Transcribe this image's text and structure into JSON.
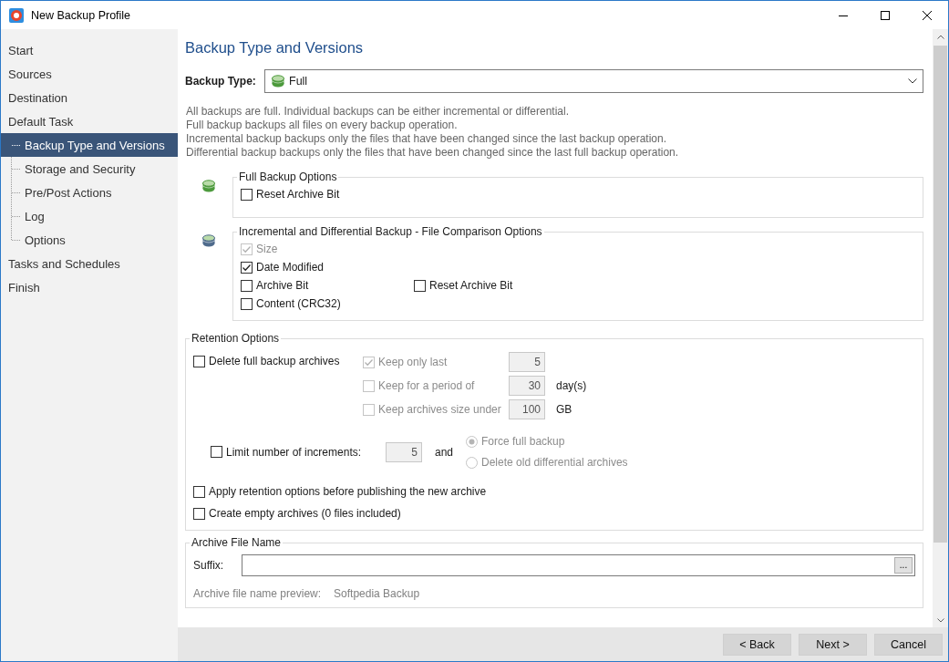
{
  "window": {
    "title": "New Backup Profile"
  },
  "sidebar": {
    "items": [
      {
        "label": "Start",
        "selected": false
      },
      {
        "label": "Sources",
        "selected": false
      },
      {
        "label": "Destination",
        "selected": false
      },
      {
        "label": "Default Task",
        "selected": false,
        "children": [
          {
            "label": "Backup Type and Versions",
            "selected": true
          },
          {
            "label": "Storage and Security",
            "selected": false
          },
          {
            "label": "Pre/Post Actions",
            "selected": false
          },
          {
            "label": "Log",
            "selected": false
          },
          {
            "label": "Options",
            "selected": false
          }
        ]
      },
      {
        "label": "Tasks and Schedules",
        "selected": false
      },
      {
        "label": "Finish",
        "selected": false
      }
    ]
  },
  "page_title": "Backup Type and Versions",
  "backup_type": {
    "label": "Backup Type:",
    "value": "Full"
  },
  "description": [
    "All backups are full. Individual backups can be either incremental or differential.",
    "Full backup backups all files on every backup operation.",
    "Incremental backup backups only the files that have been changed since the last backup operation.",
    "Differential backup backups only the files that have been changed since the last full backup operation."
  ],
  "full_backup_options": {
    "title": "Full Backup Options",
    "options": [
      {
        "label": "Reset Archive Bit",
        "checked": false,
        "disabled": false
      }
    ]
  },
  "comparison_options": {
    "title": "Incremental and Differential Backup - File Comparison Options",
    "rows": [
      {
        "options": [
          {
            "label": "Size",
            "checked": true,
            "disabled": true
          }
        ]
      },
      {
        "options": [
          {
            "label": "Date Modified",
            "checked": true,
            "disabled": false
          }
        ]
      },
      {
        "options": [
          {
            "label": "Archive Bit",
            "checked": false,
            "disabled": false
          },
          {
            "label": "Reset Archive Bit",
            "checked": false,
            "disabled": false
          }
        ]
      },
      {
        "options": [
          {
            "label": "Content (CRC32)",
            "checked": false,
            "disabled": false
          }
        ]
      }
    ]
  },
  "retention": {
    "title": "Retention Options",
    "delete_full": {
      "label": "Delete full backup archives",
      "checked": false,
      "disabled": false
    },
    "keep_rules": [
      {
        "label": "Keep only last",
        "checked": true,
        "disabled": true,
        "value": "5"
      },
      {
        "label": "Keep for a period of",
        "checked": false,
        "disabled": true,
        "value": "30",
        "unit": "day(s)"
      },
      {
        "label": "Keep archives size under",
        "checked": false,
        "disabled": true,
        "value": "100",
        "unit": "GB"
      }
    ],
    "limit_increments": {
      "label": "Limit number of increments:",
      "checked": false,
      "disabled": false,
      "value": "5",
      "joiner": "and"
    },
    "increment_actions": [
      {
        "label": "Force full backup",
        "selected": true,
        "disabled": true
      },
      {
        "label": "Delete old differential archives",
        "selected": false,
        "disabled": true
      }
    ],
    "extra_options": [
      {
        "label": "Apply retention options before publishing the new archive",
        "checked": false,
        "disabled": false
      },
      {
        "label": "Create empty archives (0 files included)",
        "checked": false,
        "disabled": false
      }
    ]
  },
  "archive_file_name": {
    "title": "Archive File Name",
    "suffix_label": "Suffix:",
    "browse_label": "...",
    "preview_label": "Archive file name preview:",
    "preview_value": "Softpedia Backup"
  },
  "buttons": [
    {
      "label": "< Back"
    },
    {
      "label": "Next >"
    },
    {
      "label": "Cancel"
    }
  ]
}
